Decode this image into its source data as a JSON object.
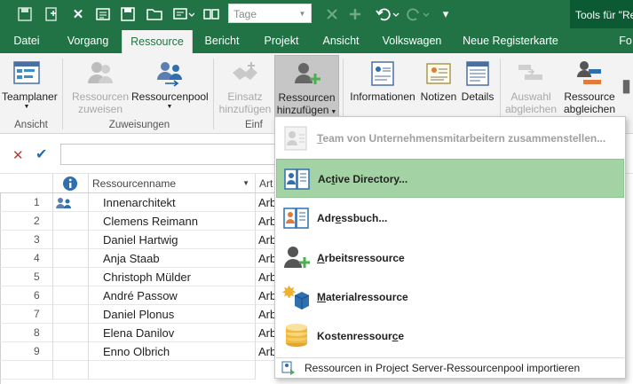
{
  "qat": {
    "zoom_value": "Tage",
    "tools_context": "Tools für \"Re"
  },
  "tabs": [
    {
      "label": "Datei"
    },
    {
      "label": "Vorgang"
    },
    {
      "label": "Ressource"
    },
    {
      "label": "Bericht"
    },
    {
      "label": "Projekt"
    },
    {
      "label": "Ansicht"
    },
    {
      "label": "Volkswagen"
    },
    {
      "label": "Neue Registerkarte"
    },
    {
      "label": "Fo"
    }
  ],
  "ribbon": {
    "teamplaner": "Teamplaner",
    "ressourcen_zuweisen_1": "Ressourcen",
    "ressourcen_zuweisen_2": "zuweisen",
    "ressourcenpool": "Ressourcenpool",
    "einsatz_1": "Einsatz",
    "einsatz_2": "hinzufügen",
    "ress_hinz_1": "Ressourcen",
    "ress_hinz_2": "hinzufügen",
    "informationen": "Informationen",
    "notizen": "Notizen",
    "details": "Details",
    "auswahl_1": "Auswahl",
    "auswahl_2": "abgleichen",
    "ress_abgl_1": "Ressource",
    "ress_abgl_2": "abgleichen",
    "group_ansicht": "Ansicht",
    "group_zuweisungen": "Zuweisungen",
    "group_einf": "Einf"
  },
  "grid": {
    "header_name": "Ressourcenname",
    "header_type": "Art",
    "rows": [
      {
        "num": "1",
        "name": "Innenarchitekt",
        "type": "Arb"
      },
      {
        "num": "2",
        "name": "Clemens Reimann",
        "type": "Arb"
      },
      {
        "num": "3",
        "name": "Daniel Hartwig",
        "type": "Arb"
      },
      {
        "num": "4",
        "name": "Anja Staab",
        "type": "Arb"
      },
      {
        "num": "5",
        "name": "Christoph Mülder",
        "type": "Arb"
      },
      {
        "num": "6",
        "name": "André Passow",
        "type": "Arb"
      },
      {
        "num": "7",
        "name": "Daniel Plonus",
        "type": "Arb"
      },
      {
        "num": "8",
        "name": "Elena Danilov",
        "type": "Arb"
      },
      {
        "num": "9",
        "name": "Enno Olbrich",
        "type": "Arb"
      }
    ]
  },
  "menu": {
    "team_pre": "",
    "team_u": "T",
    "team_post": "eam von Unternehmensmitarbeitern zusammenstellen...",
    "ad_pre": "Ac",
    "ad_u": "t",
    "ad_post": "ive Directory...",
    "ab_pre": "Adr",
    "ab_u": "e",
    "ab_post": "ssbuch...",
    "ar_pre": "",
    "ar_u": "A",
    "ar_post": "rbeitsressource",
    "mr_pre": "",
    "mr_u": "M",
    "mr_post": "aterialressource",
    "kr_pre": "Kostenressour",
    "kr_u": "c",
    "kr_post": "e",
    "import": "Ressourcen in Project Server-Ressourcenpool importieren"
  },
  "colors": {
    "accent": "#217346",
    "highlight": "#a3d3a5"
  }
}
